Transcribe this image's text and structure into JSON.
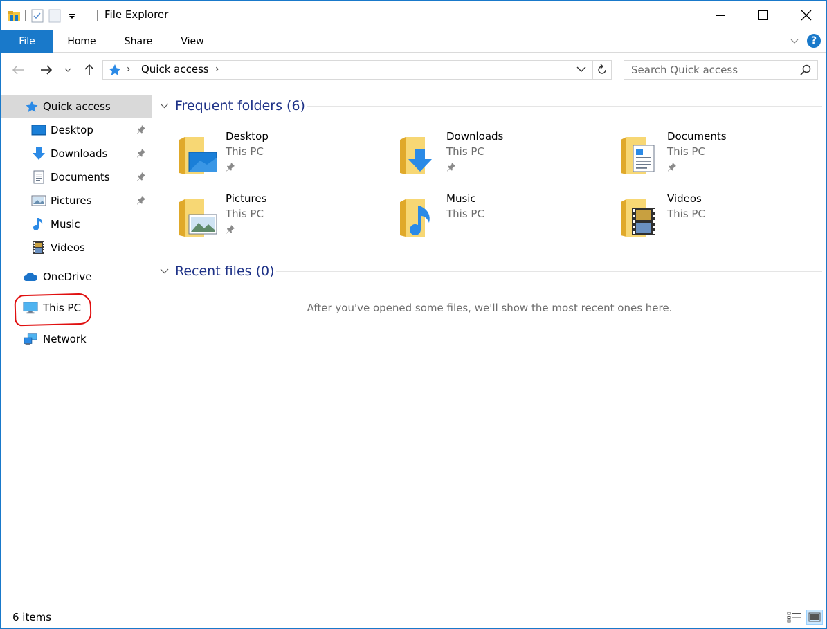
{
  "window": {
    "title": "File Explorer"
  },
  "ribbon": {
    "tabs": [
      {
        "label": "File"
      },
      {
        "label": "Home"
      },
      {
        "label": "Share"
      },
      {
        "label": "View"
      }
    ]
  },
  "address_bar": {
    "location": "Quick access",
    "search_placeholder": "Search Quick access"
  },
  "nav_pane": {
    "quick_access": "Quick access",
    "pinned": [
      {
        "label": "Desktop",
        "icon": "desktop-icon",
        "pinned": true
      },
      {
        "label": "Downloads",
        "icon": "downloads-icon",
        "pinned": true
      },
      {
        "label": "Documents",
        "icon": "documents-icon",
        "pinned": true
      },
      {
        "label": "Pictures",
        "icon": "pictures-icon",
        "pinned": true
      },
      {
        "label": "Music",
        "icon": "music-icon",
        "pinned": false
      },
      {
        "label": "Videos",
        "icon": "videos-icon",
        "pinned": false
      }
    ],
    "onedrive": "OneDrive",
    "this_pc": "This PC",
    "network": "Network"
  },
  "content": {
    "frequent_header": "Frequent folders (6)",
    "recent_header": "Recent files (0)",
    "empty_message": "After you've opened some files, we'll show the most recent ones here.",
    "folders": [
      {
        "name": "Desktop",
        "location": "This PC",
        "pinned": true
      },
      {
        "name": "Downloads",
        "location": "This PC",
        "pinned": true
      },
      {
        "name": "Documents",
        "location": "This PC",
        "pinned": true
      },
      {
        "name": "Pictures",
        "location": "This PC",
        "pinned": true
      },
      {
        "name": "Music",
        "location": "This PC",
        "pinned": false
      },
      {
        "name": "Videos",
        "location": "This PC",
        "pinned": false
      }
    ]
  },
  "status_bar": {
    "item_count": "6 items"
  },
  "colors": {
    "accent": "#1979ca",
    "header_text": "#1e3287",
    "folder_yellow": "#f5c643",
    "annotation_red": "#e01010"
  }
}
